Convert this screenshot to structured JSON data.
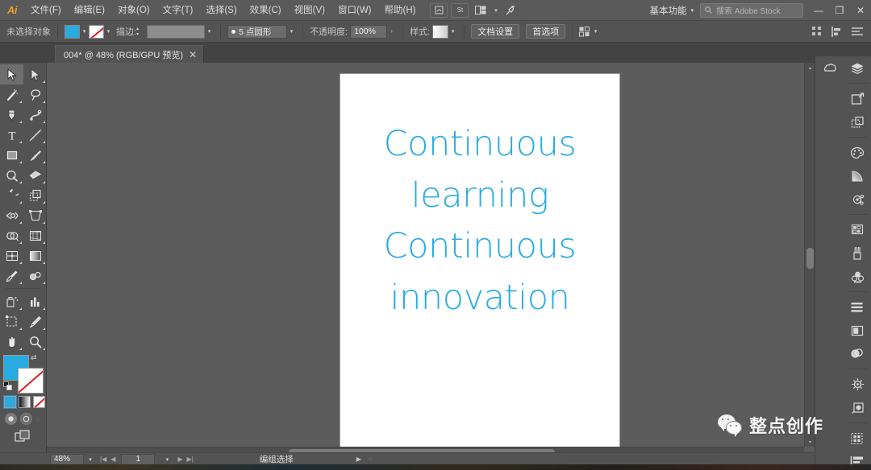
{
  "app": {
    "name": "Adobe Illustrator",
    "logo_text": "Ai"
  },
  "menubar": {
    "items": [
      {
        "label": "文件(F)",
        "name": "menu-file"
      },
      {
        "label": "编辑(E)",
        "name": "menu-edit"
      },
      {
        "label": "对象(O)",
        "name": "menu-object"
      },
      {
        "label": "文字(T)",
        "name": "menu-type"
      },
      {
        "label": "选择(S)",
        "name": "menu-select"
      },
      {
        "label": "效果(C)",
        "name": "menu-effect"
      },
      {
        "label": "视图(V)",
        "name": "menu-view"
      },
      {
        "label": "窗口(W)",
        "name": "menu-window"
      },
      {
        "label": "帮助(H)",
        "name": "menu-help"
      }
    ],
    "icons": [
      "bridge-icon",
      "stock-icon",
      "arrange-documents-icon"
    ],
    "workspace": "基本功能",
    "stock_placeholder": "搜索 Adobe Stock",
    "window_buttons": {
      "minimize": "—",
      "restore": "❐",
      "close": "✕"
    }
  },
  "controlbar": {
    "selection_label": "未选择对象",
    "fill_color": "#29abe2",
    "stroke_color": "none",
    "stroke_label": "描边:",
    "stroke_weight": "",
    "brush_label": "5 点圆形",
    "opacity_label": "不透明度:",
    "opacity_value": "100%",
    "style_label": "样式:",
    "document_setup": "文档设置",
    "preferences": "首选项"
  },
  "tabbar": {
    "document_tab": "004* @ 48% (RGB/GPU 预览)",
    "close_glyph": "✕"
  },
  "toolbar": {
    "tools": [
      {
        "name": "selection-tool",
        "active": true
      },
      {
        "name": "direct-selection-tool",
        "active": false
      },
      {
        "name": "magic-wand-tool",
        "active": false
      },
      {
        "name": "lasso-tool",
        "active": false
      },
      {
        "name": "pen-tool",
        "active": false
      },
      {
        "name": "curvature-tool",
        "active": false
      },
      {
        "name": "type-tool",
        "active": false
      },
      {
        "name": "line-segment-tool",
        "active": false
      },
      {
        "name": "rectangle-tool",
        "active": false
      },
      {
        "name": "paintbrush-tool",
        "active": false
      },
      {
        "name": "shaper-tool",
        "active": false
      },
      {
        "name": "eraser-tool",
        "active": false
      },
      {
        "name": "rotate-tool",
        "active": false
      },
      {
        "name": "scale-tool",
        "active": false
      },
      {
        "name": "width-tool",
        "active": false
      },
      {
        "name": "free-transform-tool",
        "active": false
      },
      {
        "name": "shape-builder-tool",
        "active": false
      },
      {
        "name": "perspective-grid-tool",
        "active": false
      },
      {
        "name": "mesh-tool",
        "active": false
      },
      {
        "name": "gradient-tool",
        "active": false
      },
      {
        "name": "eyedropper-tool",
        "active": false
      },
      {
        "name": "blend-tool",
        "active": false
      },
      {
        "name": "symbol-sprayer-tool",
        "active": false
      },
      {
        "name": "column-graph-tool",
        "active": false
      },
      {
        "name": "artboard-tool",
        "active": false
      },
      {
        "name": "slice-tool",
        "active": false
      },
      {
        "name": "hand-tool",
        "active": false
      },
      {
        "name": "zoom-tool",
        "active": false
      }
    ],
    "fill_color": "#29abe2",
    "stroke_color": "none",
    "draw_modes": [
      "color-mode",
      "gradient-mode",
      "none-mode"
    ],
    "screen_modes": [
      "normal-screen-mode",
      "full-screen-menu-mode",
      "full-screen-mode"
    ],
    "edit_toolbar": "edit-toolbar-icon"
  },
  "canvas": {
    "background_color": "#5c5c5c",
    "artboard_color": "#ffffff",
    "text_color": "#29abe2",
    "text_lines": [
      "Continuous",
      "learning",
      "Continuous",
      "innovation"
    ]
  },
  "dock": {
    "groups": [
      [
        "layers-panel-icon",
        "libraries-panel-icon"
      ],
      [
        "artboards-panel-icon",
        "asset-export-panel-icon"
      ],
      [
        "color-panel-icon",
        "gradient-panel-icon",
        "color-guide-panel-icon"
      ],
      [
        "swatches-panel-icon",
        "brushes-panel-icon",
        "symbols-panel-icon"
      ],
      [
        "align-panel-icon",
        "transform-panel-icon",
        "pathfinder-panel-icon"
      ],
      [
        "appearance-panel-icon",
        "graphic-styles-panel-icon"
      ],
      [
        "transparency-panel-icon",
        "stroke-panel-icon"
      ]
    ]
  },
  "statusbar": {
    "zoom": "48%",
    "page": "1",
    "status_text": "编组选择",
    "nav_first": "|◀",
    "nav_prev": "◀",
    "nav_next": "▶",
    "nav_last": "▶|"
  },
  "watermark": {
    "text": "整点创作",
    "icon": "wechat-icon"
  }
}
